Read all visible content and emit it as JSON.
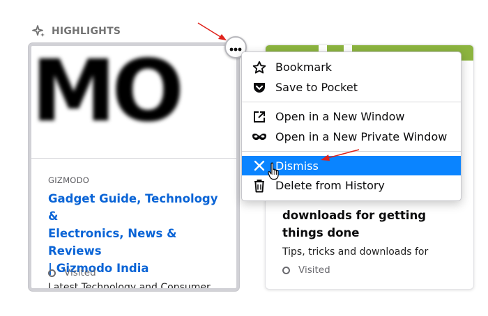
{
  "section": {
    "title": "HIGHLIGHTS",
    "icon": "sparkle-icon"
  },
  "cards": [
    {
      "thumbnail_text": "MO",
      "host": "GIZMODO",
      "title": "Gadget Guide, Technology & Electronics, News & Reviews | Gizmodo India",
      "title_lines": [
        "Gadget Guide, Technology &",
        "Electronics, News & Reviews",
        "| Gizmodo India"
      ],
      "description": "Latest Technology and Consumer",
      "context": "Visited"
    },
    {
      "title_lines": [
        "downloads for getting",
        "things done"
      ],
      "description": "Tips, tricks and downloads for",
      "context": "Visited"
    }
  ],
  "menu": {
    "open_button_icon": "meatball-icon",
    "items": [
      {
        "label": "Bookmark",
        "icon": "star-icon"
      },
      {
        "label": "Save to Pocket",
        "icon": "pocket-icon"
      },
      {
        "label": "Open in a New Window",
        "icon": "new-window-icon"
      },
      {
        "label": "Open in a New Private Window",
        "icon": "mask-icon"
      },
      {
        "label": "Dismiss",
        "icon": "close-icon"
      },
      {
        "label": "Delete from History",
        "icon": "trash-icon"
      }
    ],
    "selected_index": 4
  },
  "colors": {
    "link_blue": "#0a64d6",
    "selection_blue": "#0a84ff",
    "annotation_red": "#e0231c",
    "thumbnail_green": "#8cb43f"
  }
}
